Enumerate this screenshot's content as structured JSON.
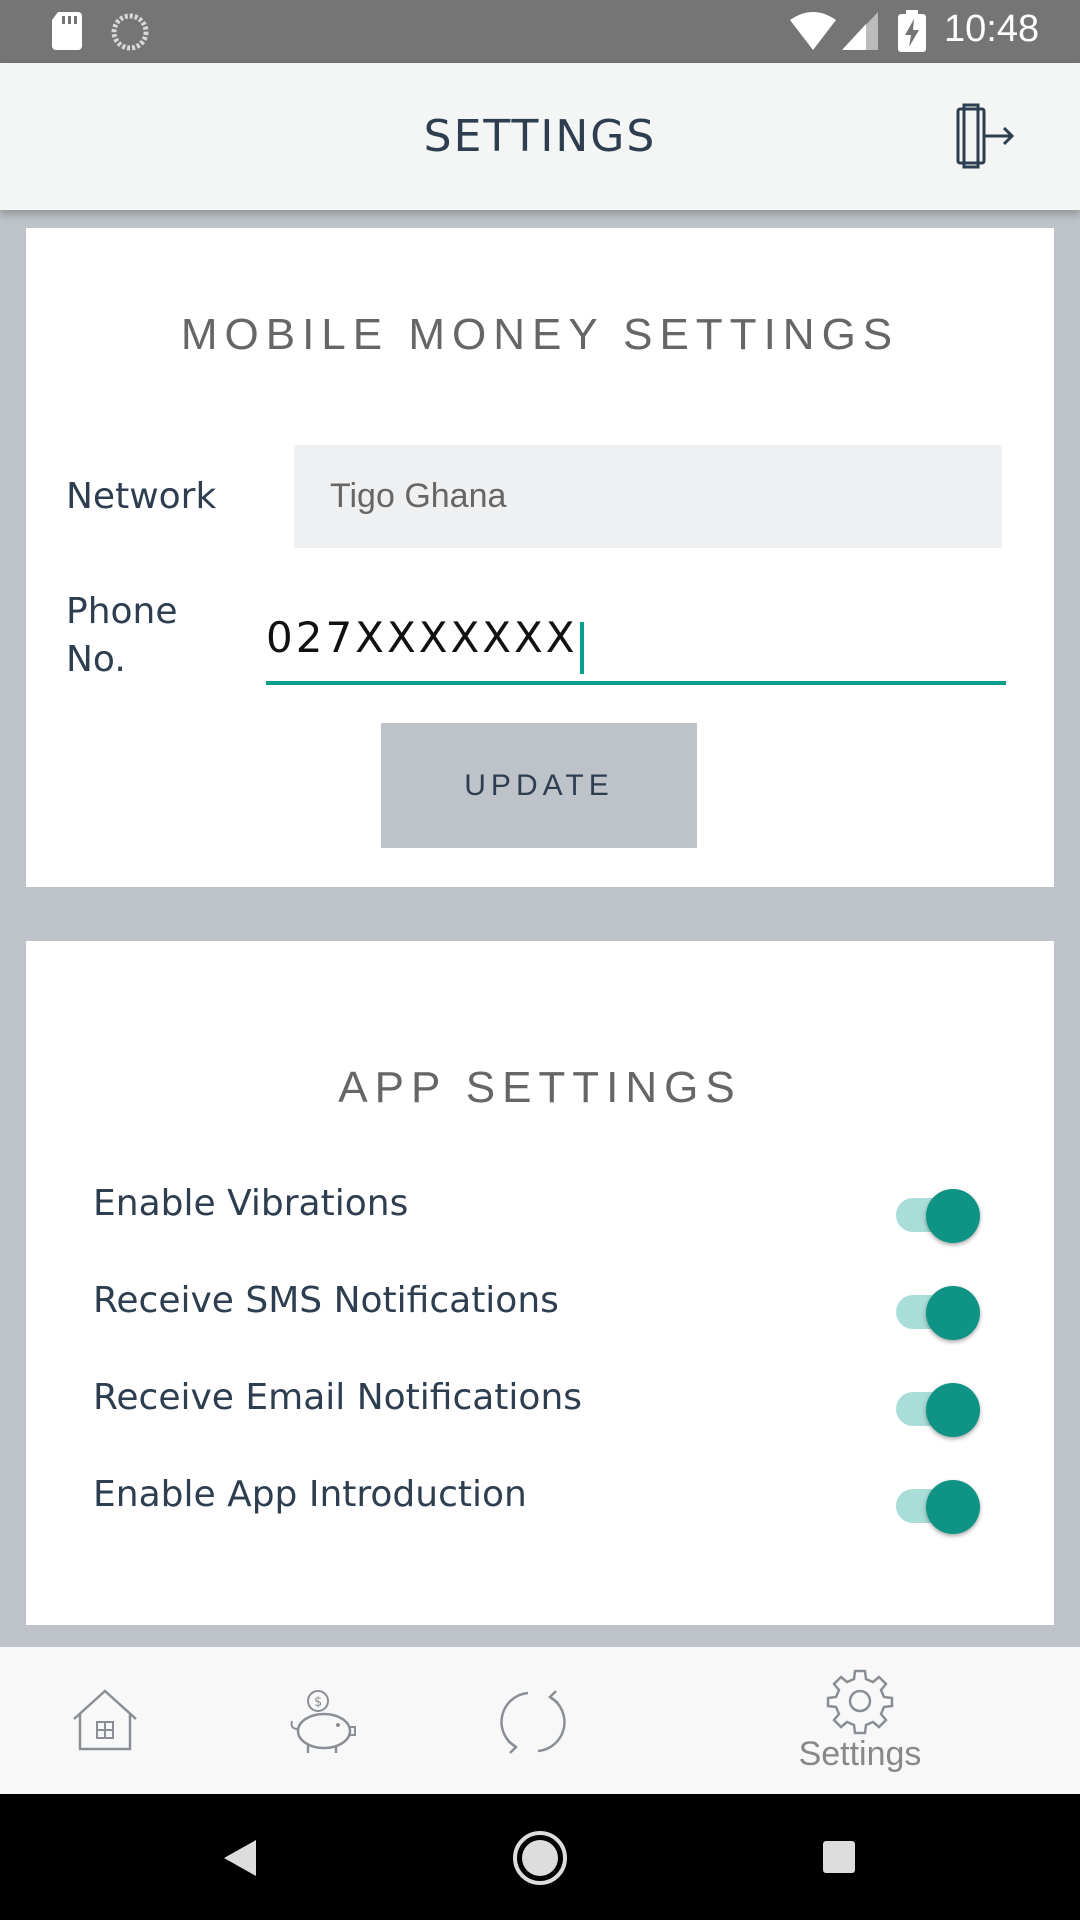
{
  "status_bar": {
    "time": "10:48"
  },
  "header": {
    "title": "SETTINGS"
  },
  "mobile_money": {
    "title": "MOBILE MONEY SETTINGS",
    "network_label": "Network",
    "network_value": "Tigo Ghana",
    "phone_label_line1": "Phone",
    "phone_label_line2": "No.",
    "phone_value": "027XXXXXXX",
    "update_label": "UPDATE"
  },
  "app_settings": {
    "title": "APP SETTINGS",
    "toggles": [
      {
        "label": "Enable Vibrations",
        "on": true
      },
      {
        "label": "Receive SMS Notifications",
        "on": true
      },
      {
        "label": "Receive Email Notifications",
        "on": true
      },
      {
        "label": "Enable App Introduction",
        "on": true
      }
    ]
  },
  "bottom_nav": {
    "items": [
      {
        "icon": "home-icon"
      },
      {
        "icon": "piggy-bank-icon"
      },
      {
        "icon": "refresh-icon"
      },
      {
        "icon": "gear-icon",
        "label": "Settings",
        "active": true
      }
    ]
  },
  "colors": {
    "accent": "#0e9384",
    "status_bar": "#757575",
    "background": "#bdc3c8",
    "text_dark": "#2d3e50"
  }
}
